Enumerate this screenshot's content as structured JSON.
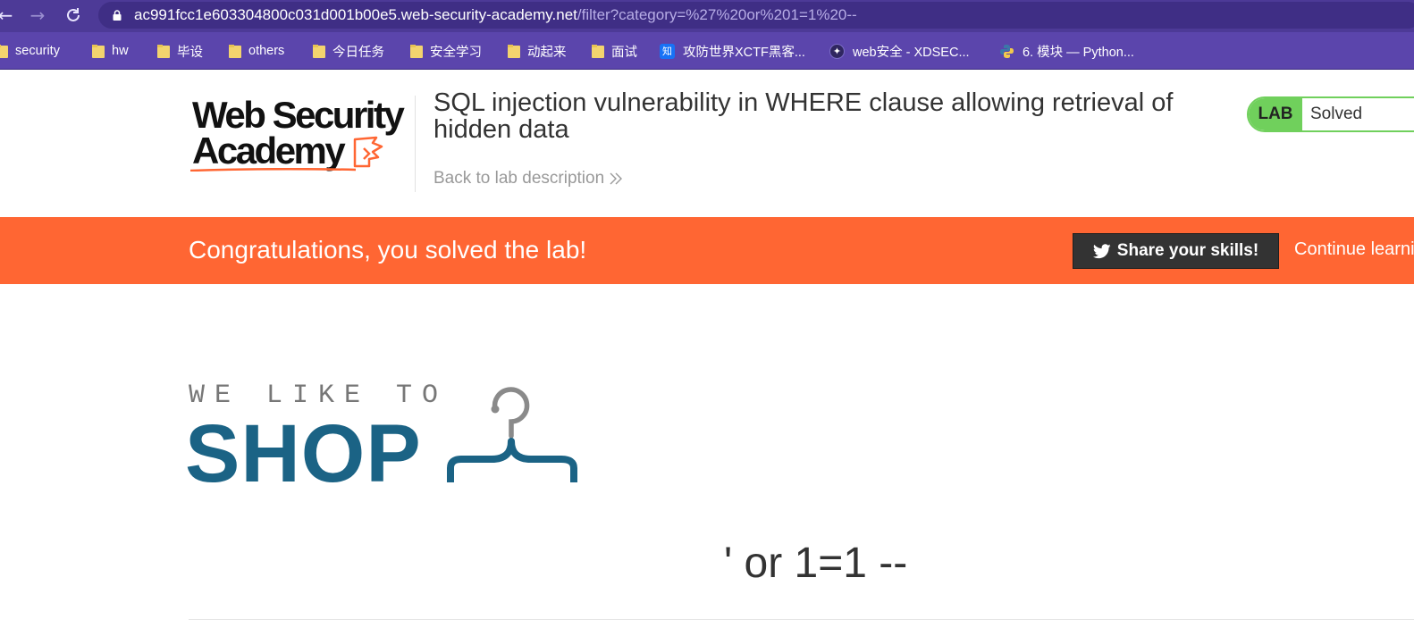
{
  "browser": {
    "url_host": "ac991fcc1e603304800c031d001b00e5.web-security-academy.net",
    "url_path": "/filter?category=%27%20or%201=1%20--",
    "bookmarks": [
      {
        "label": "security",
        "icon": "folder-icon"
      },
      {
        "label": "hw",
        "icon": "folder-icon"
      },
      {
        "label": "毕设",
        "icon": "folder-icon"
      },
      {
        "label": "others",
        "icon": "folder-icon"
      },
      {
        "label": "今日任务",
        "icon": "folder-icon"
      },
      {
        "label": "安全学习",
        "icon": "folder-icon"
      },
      {
        "label": "动起来",
        "icon": "folder-icon"
      },
      {
        "label": "面试",
        "icon": "folder-icon"
      },
      {
        "label": "攻防世界XCTF黑客...",
        "icon": "zhihu-icon",
        "icon_text": "知"
      },
      {
        "label": "web安全 - XDSEC...",
        "icon": "xdsec-icon"
      },
      {
        "label": "6. 模块 — Python...",
        "icon": "python-icon"
      }
    ]
  },
  "header": {
    "logo_line1": "Web Security",
    "logo_line2": "Academy",
    "lab_title": "SQL injection vulnerability in WHERE clause allowing retrieval of hidden data",
    "back_link": "Back to lab description",
    "lab_badge": "LAB",
    "lab_state": "Solved"
  },
  "banner": {
    "message": "Congratulations, you solved the lab!",
    "share_label": "Share your skills!",
    "continue_label": "Continue learning"
  },
  "shop": {
    "tagline": "WE LIKE TO",
    "word": "SHOP",
    "category_title": "' or 1=1 --"
  },
  "colors": {
    "browser_chrome": "#4d3a97",
    "bookmark_bar": "#5b45ac",
    "banner": "#ff6633",
    "lab_solved": "#70d05c",
    "shop_blue": "#1b6385"
  }
}
